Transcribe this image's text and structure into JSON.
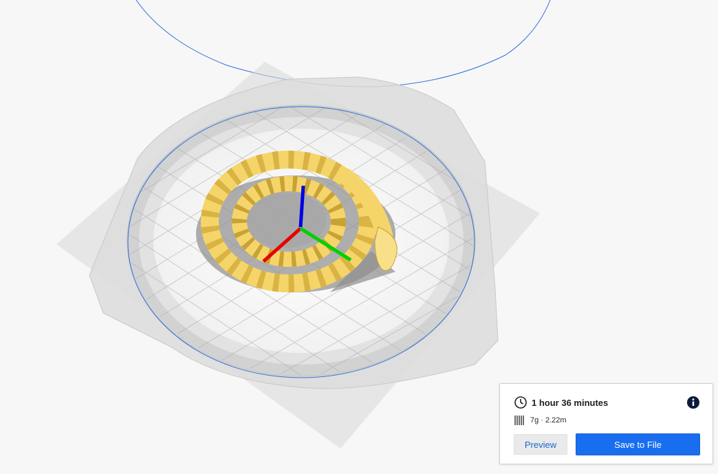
{
  "print_summary": {
    "print_time": "1 hour 36 minutes",
    "material_usage": "7g · 2.22m",
    "preview_label": "Preview",
    "save_label": "Save to File"
  },
  "colors": {
    "accent": "#196ef0",
    "build_volume_outline": "#2f6fd8",
    "model": "#f5d56a",
    "axis_x": "#e60000",
    "axis_y": "#00d000",
    "axis_z": "#0000e6"
  },
  "icons": {
    "print_time": "clock-icon",
    "material": "filament-spool-icon",
    "details": "info-icon"
  },
  "viewport": {
    "scene": "3d-build-plate",
    "model": "coiled-snake"
  }
}
